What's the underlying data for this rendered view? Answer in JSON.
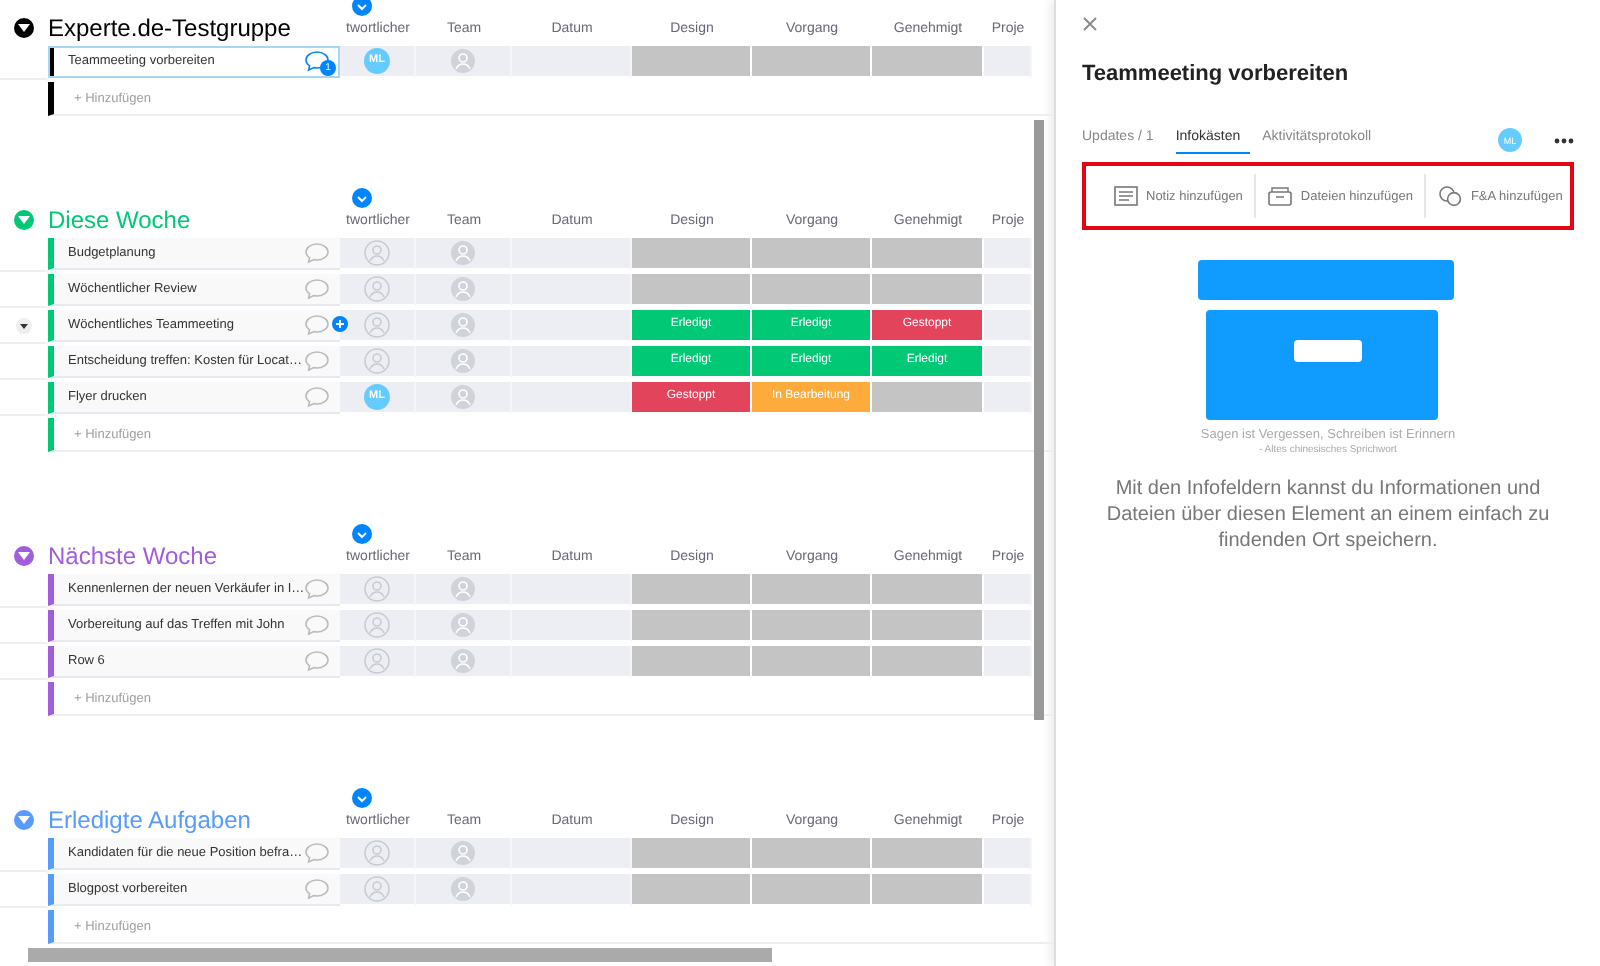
{
  "groups": [
    {
      "title": "Experte.de-Testgruppe",
      "color": "#000000",
      "columns": [
        "twortlicher",
        "Team",
        "Datum",
        "Design",
        "Vorgang",
        "Genehmigt",
        "Proje"
      ],
      "rows": [
        {
          "name": "Teammeeting vorbereiten",
          "selected": true,
          "hovered": false,
          "comments": "1",
          "owner": "ML",
          "cells": [
            {
              "color": "#c4c4c4"
            },
            {
              "color": "#c4c4c4"
            },
            {
              "color": "#c4c4c4"
            }
          ]
        }
      ],
      "add_label": "+ Hinzufügen"
    },
    {
      "title": "Diese Woche",
      "color": "#00c875",
      "columns": [
        "twortlicher",
        "Team",
        "Datum",
        "Design",
        "Vorgang",
        "Genehmigt",
        "Proje"
      ],
      "rows": [
        {
          "name": "Budgetplanung",
          "selected": false,
          "hovered": false,
          "cells": [
            {
              "color": "#c4c4c4"
            },
            {
              "color": "#c4c4c4"
            },
            {
              "color": "#c4c4c4"
            }
          ]
        },
        {
          "name": "Wöchentlicher Review",
          "selected": false,
          "hovered": false,
          "cells": [
            {
              "color": "#c4c4c4"
            },
            {
              "color": "#c4c4c4"
            },
            {
              "color": "#c4c4c4"
            }
          ]
        },
        {
          "name": "Wöchentliches Teammeeting",
          "selected": false,
          "hovered": true,
          "cells": [
            {
              "label": "Erledigt",
              "color": "#00c875"
            },
            {
              "label": "Erledigt",
              "color": "#00c875"
            },
            {
              "label": "Gestoppt",
              "color": "#e2445c"
            }
          ]
        },
        {
          "name": "Entscheidung treffen: Kosten für Locat…",
          "selected": false,
          "hovered": false,
          "cells": [
            {
              "label": "Erledigt",
              "color": "#00c875"
            },
            {
              "label": "Erledigt",
              "color": "#00c875"
            },
            {
              "label": "Erledigt",
              "color": "#00c875"
            }
          ]
        },
        {
          "name": "Flyer drucken",
          "selected": false,
          "hovered": false,
          "owner": "ML",
          "cells": [
            {
              "label": "Gestoppt",
              "color": "#e2445c"
            },
            {
              "label": "In Bearbeitung",
              "color": "#fdab3d"
            },
            {
              "color": "#c4c4c4"
            }
          ]
        }
      ],
      "add_label": "+ Hinzufügen"
    },
    {
      "title": "Nächste Woche",
      "color": "#a25ddc",
      "columns": [
        "twortlicher",
        "Team",
        "Datum",
        "Design",
        "Vorgang",
        "Genehmigt",
        "Proje"
      ],
      "rows": [
        {
          "name": "Kennenlernen der neuen Verkäufer in I…",
          "selected": false,
          "hovered": false,
          "cells": [
            {
              "color": "#c4c4c4"
            },
            {
              "color": "#c4c4c4"
            },
            {
              "color": "#c4c4c4"
            }
          ]
        },
        {
          "name": "Vorbereitung auf das Treffen mit John",
          "selected": false,
          "hovered": false,
          "cells": [
            {
              "color": "#c4c4c4"
            },
            {
              "color": "#c4c4c4"
            },
            {
              "color": "#c4c4c4"
            }
          ]
        },
        {
          "name": "Row 6",
          "selected": false,
          "hovered": false,
          "cells": [
            {
              "color": "#c4c4c4"
            },
            {
              "color": "#c4c4c4"
            },
            {
              "color": "#c4c4c4"
            }
          ]
        }
      ],
      "add_label": "+ Hinzufügen"
    },
    {
      "title": "Erledigte Aufgaben",
      "color": "#579bfc",
      "columns": [
        "twortlicher",
        "Team",
        "Datum",
        "Design",
        "Vorgang",
        "Genehmigt",
        "Proje"
      ],
      "rows": [
        {
          "name": "Kandidaten für die neue Position befra…",
          "selected": false,
          "hovered": false,
          "cells": [
            {
              "color": "#c4c4c4"
            },
            {
              "color": "#c4c4c4"
            },
            {
              "color": "#c4c4c4"
            }
          ]
        },
        {
          "name": "Blogpost vorbereiten",
          "selected": false,
          "hovered": false,
          "cells": [
            {
              "color": "#c4c4c4"
            },
            {
              "color": "#c4c4c4"
            },
            {
              "color": "#c4c4c4"
            }
          ]
        }
      ],
      "add_label": "+ Hinzufügen"
    }
  ],
  "panel": {
    "title": "Teammeeting vorbereiten",
    "tabs": [
      {
        "label": "Updates / 1",
        "selected": false
      },
      {
        "label": "Infokästen",
        "selected": true
      },
      {
        "label": "Aktivitätsprotokoll",
        "selected": false
      }
    ],
    "avatar": "ML",
    "actions_highlighted": true,
    "actions": [
      {
        "kind": "note",
        "label": "Notiz hinzufügen"
      },
      {
        "kind": "files",
        "label": "Dateien hinzufügen"
      },
      {
        "kind": "qa",
        "label": "F&A hinzufügen"
      }
    ],
    "quote": "Sagen ist Vergessen, Schreiben ist Erinnern",
    "attribution": "- Altes chinesisches Sprichwort",
    "description": "Mit den Infofeldern kannst du Informationen und Dateien über diesen Element an einem einfach zu findenden Ort speichern."
  }
}
